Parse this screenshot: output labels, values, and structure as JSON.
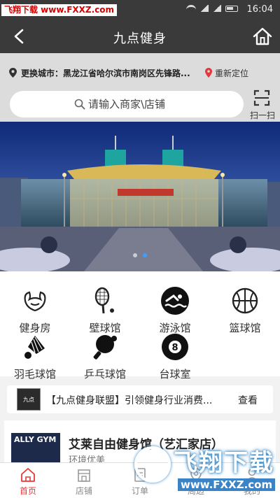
{
  "status_bar": {
    "watermark": "飞翔下载 www.FXXZ.com",
    "time": "16:04"
  },
  "nav": {
    "title": "九点健身",
    "back_icon": "back-arrow-icon",
    "home_icon": "home-icon"
  },
  "location": {
    "text": "更换城市：黑龙江省哈尔滨市南岗区先锋路...",
    "relocate_label": "重新定位"
  },
  "search": {
    "placeholder": "请输入商家\\店铺",
    "scan_label": "扫一扫"
  },
  "categories": [
    {
      "label": "健身房",
      "icon": "muscle-icon"
    },
    {
      "label": "壁球馆",
      "icon": "squash-racket-icon"
    },
    {
      "label": "游泳馆",
      "icon": "swimmer-icon"
    },
    {
      "label": "篮球馆",
      "icon": "basketball-icon"
    },
    {
      "label": "羽毛球馆",
      "icon": "shuttlecock-icon"
    },
    {
      "label": "乒乓球馆",
      "icon": "ping-pong-icon"
    },
    {
      "label": "台球室",
      "icon": "billiard-ball-icon"
    }
  ],
  "news": {
    "logo_text": "九点",
    "text": "【九点健身联盟】引领健身行业消费...",
    "more_label": "查看"
  },
  "store": {
    "thumb_text": "ALLY GYM",
    "name": "艾莱自由健身馆（艺汇家店）",
    "sub": "环境优美"
  },
  "tabs": [
    {
      "label": "首页",
      "icon": "home-tab-icon",
      "active": true
    },
    {
      "label": "店铺",
      "icon": "store-tab-icon",
      "active": false
    },
    {
      "label": "订单",
      "icon": "order-tab-icon",
      "active": false
    },
    {
      "label": "周边",
      "icon": "nearby-tab-icon",
      "active": false
    },
    {
      "label": "我的",
      "icon": "profile-tab-icon",
      "active": false
    }
  ],
  "overlay_watermark": {
    "logo_text": "飞翔下载",
    "url": "www.FXXZ.com"
  },
  "colors": {
    "header_bg": "#3a3a3a",
    "accent_active": "#e5383b",
    "slider_dot_active": "#3aa0ff"
  }
}
